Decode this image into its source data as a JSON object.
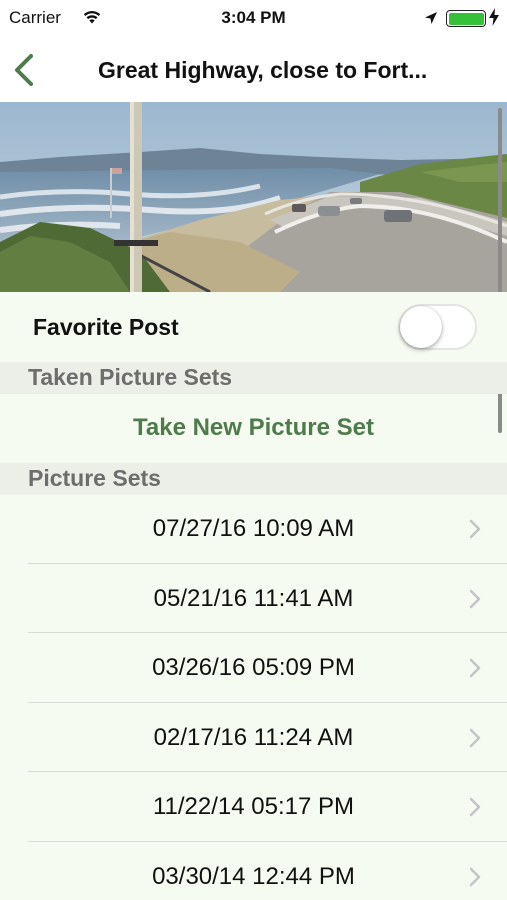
{
  "status_bar": {
    "carrier": "Carrier",
    "time": "3:04 PM",
    "battery_color": "#35c23a"
  },
  "nav": {
    "back_icon": "chevron-left-icon",
    "title": "Great Highway, close to Fort...",
    "accent_color": "#4e7a4c"
  },
  "favorite": {
    "label": "Favorite Post",
    "toggle_on": false
  },
  "taken_section": {
    "header": "Taken Picture Sets",
    "action_label": "Take New Picture Set"
  },
  "picture_sets": {
    "header": "Picture Sets",
    "items": [
      "07/27/16 10:09 AM",
      "05/21/16 11:41 AM",
      "03/26/16 05:09 PM",
      "02/17/16 11:24 AM",
      "11/22/14 05:17 PM",
      "03/30/14 12:44 PM"
    ]
  }
}
